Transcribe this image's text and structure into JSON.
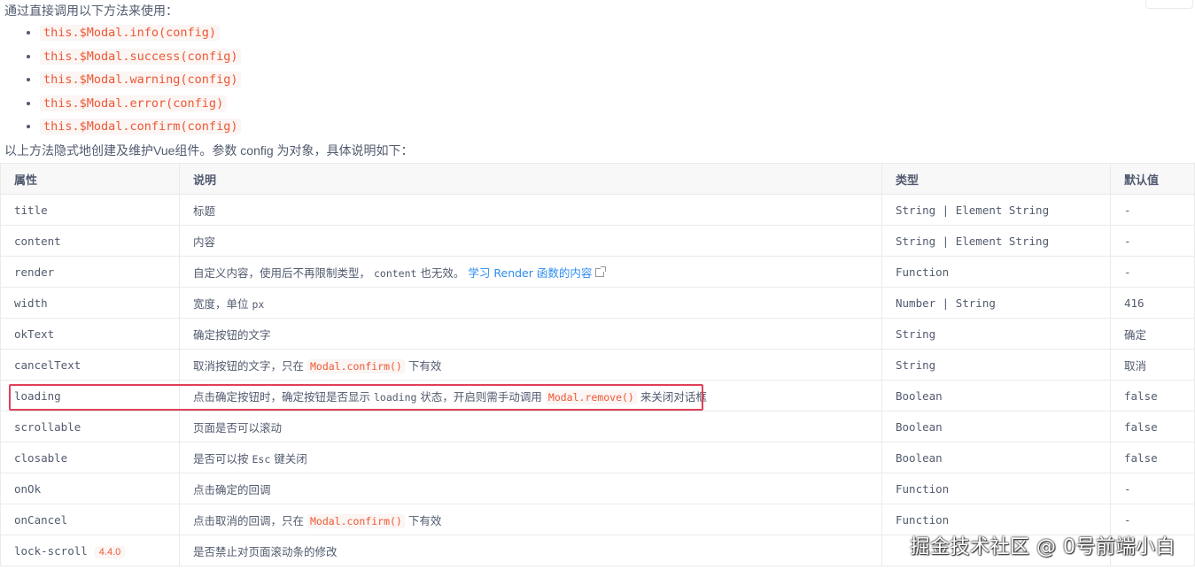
{
  "intro_text": "通过直接调用以下方法来使用：",
  "methods": [
    "this.$Modal.info(config)",
    "this.$Modal.success(config)",
    "this.$Modal.warning(config)",
    "this.$Modal.error(config)",
    "this.$Modal.confirm(config)"
  ],
  "description": "以上方法隐式地创建及维护Vue组件。参数 config 为对象，具体说明如下：",
  "table": {
    "headers": [
      "属性",
      "说明",
      "类型",
      "默认值"
    ],
    "rows": [
      {
        "prop": "title",
        "desc": "标题",
        "type": "String | Element String",
        "default": "-"
      },
      {
        "prop": "content",
        "desc": "内容",
        "type": "String | Element String",
        "default": "-"
      },
      {
        "prop": "render",
        "desc_pre": "自定义内容，使用后不再限制类型， ",
        "desc_code": "content",
        "desc_post": " 也无效。 ",
        "desc_link": "学习 Render 函数的内容",
        "type": "Function",
        "default": "-"
      },
      {
        "prop": "width",
        "desc_pre": "宽度，单位 ",
        "desc_code": "px",
        "type": "Number | String",
        "default": "416"
      },
      {
        "prop": "okText",
        "desc": "确定按钮的文字",
        "type": "String",
        "default": "确定"
      },
      {
        "prop": "cancelText",
        "desc_pre": "取消按钮的文字，只在 ",
        "desc_code": "Modal.confirm()",
        "desc_post": " 下有效",
        "type": "String",
        "default": "取消"
      },
      {
        "prop": "loading",
        "desc_pre": "点击确定按钮时，确定按钮是否显示 ",
        "desc_mono": "loading",
        "desc_mid": " 状态，开启则需手动调用 ",
        "desc_code": "Modal.remove()",
        "desc_post": " 来关闭对话框",
        "type": "Boolean",
        "default": "false"
      },
      {
        "prop": "scrollable",
        "desc": "页面是否可以滚动",
        "type": "Boolean",
        "default": "false"
      },
      {
        "prop": "closable",
        "desc_pre": "是否可以按 ",
        "desc_mono": "Esc",
        "desc_post": " 键关闭",
        "type": "Boolean",
        "default": "false"
      },
      {
        "prop": "onOk",
        "desc": "点击确定的回调",
        "type": "Function",
        "default": "-"
      },
      {
        "prop": "onCancel",
        "desc_pre": "点击取消的回调，只在 ",
        "desc_code": "Modal.confirm()",
        "desc_post": " 下有效",
        "type": "Function",
        "default": "-"
      },
      {
        "prop": "lock-scroll",
        "prop_badge": "4.4.0",
        "desc": "是否禁止对页面滚动条的修改",
        "type": "",
        "default": ""
      }
    ]
  },
  "watermark": "掘金技术社区 @ 0号前端小白",
  "colors": {
    "code_text": "#ed5835",
    "code_bg": "#fbf5f3",
    "link": "#2d8cf0",
    "highlight_border": "#e0405a",
    "table_border": "#e8eaec",
    "header_bg": "#f8f8f9"
  },
  "icons": {
    "external_link": "external-link-icon"
  }
}
